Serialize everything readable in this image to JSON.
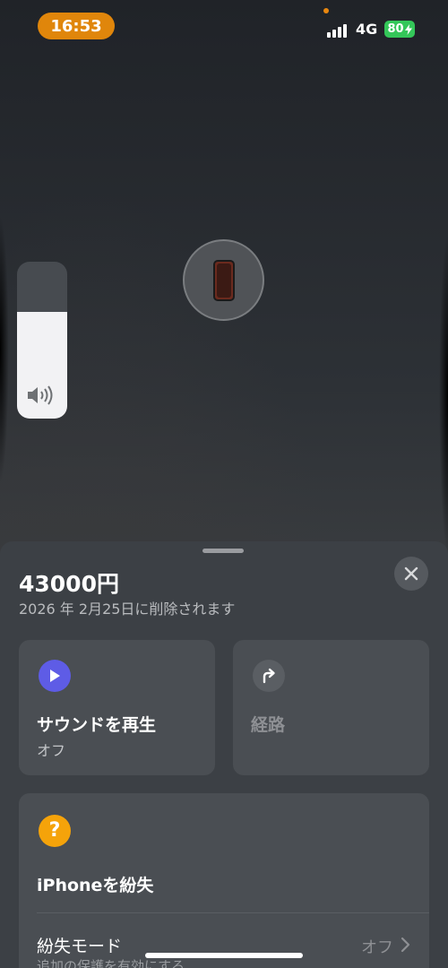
{
  "status_bar": {
    "time": "16:53",
    "network": "4G",
    "battery": "80",
    "colors": {
      "time_pill": "#e0860b",
      "battery": "#34c759",
      "privacy_dot": "#e8870f"
    }
  },
  "map": {
    "device_icon": "iphone-icon"
  },
  "volume_hud": {
    "level_fraction": 0.68,
    "icon": "speaker-volume-icon"
  },
  "sheet": {
    "title": "43000円",
    "subtitle": "2026 年 2月25日に削除されます",
    "close_icon": "close-icon",
    "actions": [
      {
        "label": "サウンドを再生",
        "value": "オフ",
        "icon": "play-icon",
        "icon_color": "#5e5ce6"
      },
      {
        "label": "経路",
        "icon": "directions-icon",
        "icon_color": "#5a5e63",
        "enabled": false
      }
    ],
    "lost_section": {
      "icon": "question-icon",
      "icon_color": "#f5a30a",
      "title": "iPhoneを紛失",
      "mode_label": "紛失モード",
      "mode_description": "追加の保護を有効にする",
      "mode_value": "オフ"
    }
  }
}
